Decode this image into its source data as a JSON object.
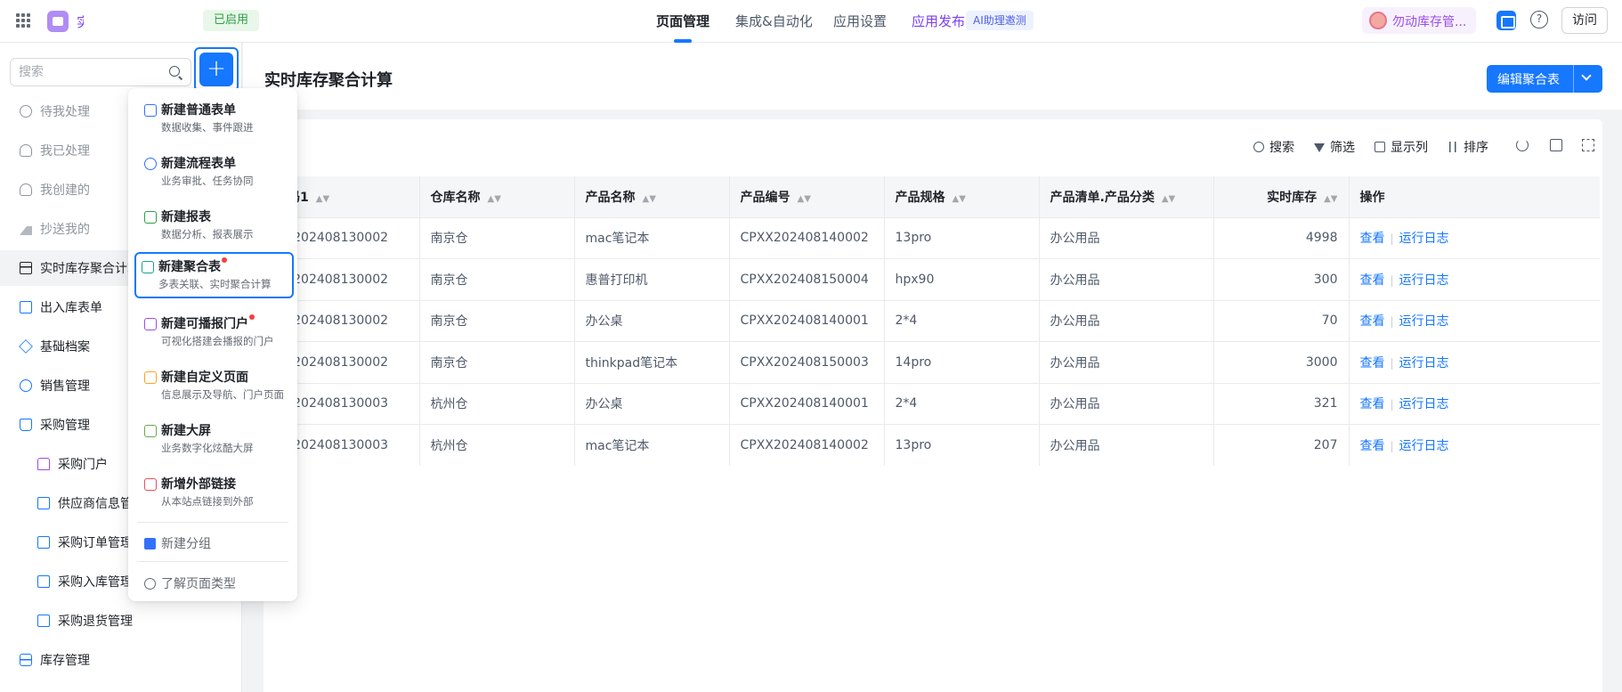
{
  "header": {
    "app_name": "实",
    "status": "已启用",
    "tabs": [
      {
        "label": "页面管理",
        "active": true
      },
      {
        "label": "集成&自动化"
      },
      {
        "label": "应用设置"
      },
      {
        "label": "应用发布"
      }
    ],
    "ai_tag": "AI助理邀测",
    "user_name": "勿动库存管...",
    "help": "?",
    "visit_label": "访问"
  },
  "sidebar": {
    "search_placeholder": "搜索",
    "add_symbol": "+",
    "items": [
      {
        "label": "待我处理",
        "icon": "clock-icon"
      },
      {
        "label": "我已处理",
        "icon": "user-check-icon"
      },
      {
        "label": "我创建的",
        "icon": "user-icon"
      },
      {
        "label": "抄送我的",
        "icon": "send-icon"
      },
      {
        "label": "实时库存聚合计算",
        "icon": "table-icon",
        "active": true
      },
      {
        "label": "出入库表单",
        "icon": "folder-icon"
      },
      {
        "label": "基础档案",
        "icon": "cube-icon"
      },
      {
        "label": "销售管理",
        "icon": "person-icon"
      },
      {
        "label": "采购管理",
        "icon": "bag-icon"
      },
      {
        "label": "采购门户",
        "icon": "house-icon"
      },
      {
        "label": "供应商信息管理",
        "icon": "doc-icon"
      },
      {
        "label": "采购订单管理",
        "icon": "doc-icon"
      },
      {
        "label": "采购入库管理",
        "icon": "doc-icon"
      },
      {
        "label": "采购退货管理",
        "icon": "doc-icon"
      },
      {
        "label": "库存管理",
        "icon": "box-icon"
      }
    ]
  },
  "dropdown": {
    "items": [
      {
        "title": "新建普通表单",
        "desc": "数据收集、事件跟进",
        "icon": "form-icon",
        "color": "#3370ff"
      },
      {
        "title": "新建流程表单",
        "desc": "业务审批、任务协同",
        "icon": "flow-icon",
        "color": "#3370ff"
      },
      {
        "title": "新建报表",
        "desc": "数据分析、报表展示",
        "icon": "report-icon",
        "color": "#2ea043"
      },
      {
        "title": "新建聚合表",
        "desc": "多表关联、实时聚合计算",
        "icon": "aggregate-icon",
        "color": "#14a38b",
        "dot": true
      },
      {
        "title": "新建可播报门户",
        "desc": "可视化搭建会播报的门户",
        "icon": "portal-icon",
        "color": "#9b4ee8",
        "dot": true
      },
      {
        "title": "新建自定义页面",
        "desc": "信息展示及导航、门户页面",
        "icon": "page-icon",
        "color": "#f7a520"
      },
      {
        "title": "新建大屏",
        "desc": "业务数字化炫酷大屏",
        "icon": "screen-icon",
        "color": "#6aa84f"
      },
      {
        "title": "新增外部链接",
        "desc": "从本站点链接到外部",
        "icon": "link-icon",
        "color": "#e8505b"
      }
    ],
    "new_group": "新建分组",
    "learn_types": "了解页面类型"
  },
  "main": {
    "title": "实时库存聚合计算",
    "edit_button": "编辑聚合表",
    "toolbar": [
      "搜索",
      "筛选",
      "显示列",
      "排序"
    ],
    "columns": [
      "编码1",
      "仓库名称",
      "产品名称",
      "产品编号",
      "产品规格",
      "产品清单.产品分类",
      "实时库存",
      "操作"
    ],
    "rows": [
      [
        "BH202408130002",
        "南京仓",
        "mac笔记本",
        "CPXX202408140002",
        "13pro",
        "办公用品",
        "4998"
      ],
      [
        "BH202408130002",
        "南京仓",
        "惠普打印机",
        "CPXX202408150004",
        "hpx90",
        "办公用品",
        "300"
      ],
      [
        "BH202408130002",
        "南京仓",
        "办公桌",
        "CPXX202408140001",
        "2*4",
        "办公用品",
        "70"
      ],
      [
        "BH202408130002",
        "南京仓",
        "thinkpad笔记本",
        "CPXX202408150003",
        "14pro",
        "办公用品",
        "3000"
      ],
      [
        "BH202408130003",
        "杭州仓",
        "办公桌",
        "CPXX202408140001",
        "2*4",
        "办公用品",
        "321"
      ],
      [
        "BH202408130003",
        "杭州仓",
        "mac笔记本",
        "CPXX202408140002",
        "13pro",
        "办公用品",
        "207"
      ]
    ],
    "op_view": "查看",
    "op_log": "运行日志",
    "op_sep": "|"
  }
}
